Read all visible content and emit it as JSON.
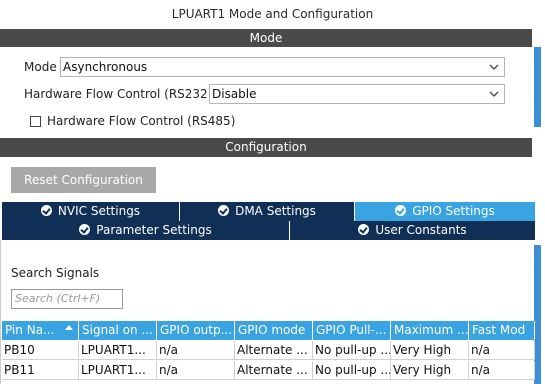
{
  "window": {
    "title": "LPUART1 Mode and Configuration"
  },
  "mode_section": {
    "header": "Mode",
    "mode_label": "Mode",
    "mode_value": "Asynchronous",
    "flow232_label": "Hardware Flow Control (RS232)",
    "flow232_value": "Disable",
    "flow485_label": "Hardware Flow Control (RS485)",
    "flow485_checked": false
  },
  "config_section": {
    "header": "Configuration",
    "reset_label": "Reset Configuration",
    "tabs_row1": [
      {
        "label": "NVIC Settings",
        "active": false
      },
      {
        "label": "DMA Settings",
        "active": false
      },
      {
        "label": "GPIO Settings",
        "active": true
      }
    ],
    "tabs_row2": [
      {
        "label": "Parameter Settings",
        "active": false
      },
      {
        "label": "User Constants",
        "active": false
      }
    ]
  },
  "gpio": {
    "search_label": "Search Signals",
    "search_placeholder": "Search (Ctrl+F)",
    "columns": [
      "Pin Na...",
      "Signal on ...",
      "GPIO outp...",
      "GPIO mode",
      "GPIO Pull-...",
      "Maximum ...",
      "Fast Mod"
    ],
    "rows": [
      [
        "PB10",
        "LPUART1...",
        "n/a",
        "Alternate ...",
        "No pull-up ...",
        "Very High",
        "n/a"
      ],
      [
        "PB11",
        "LPUART1...",
        "n/a",
        "Alternate ...",
        "No pull-up ...",
        "Very High",
        "n/a"
      ]
    ]
  },
  "colors": {
    "accent": "#3aa3e2",
    "tab_dark": "#0f2f56",
    "section_bar": "#4a4a4a"
  }
}
